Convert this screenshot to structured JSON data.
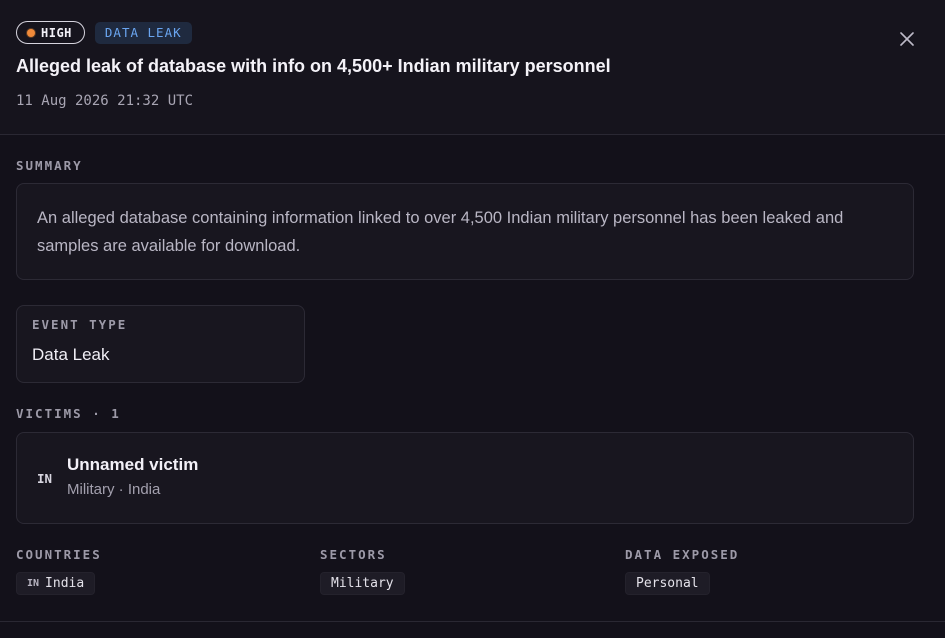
{
  "header": {
    "severity_label": "HIGH",
    "type_label": "DATA LEAK",
    "title": "Alleged leak of database with info on 4,500+ Indian military personnel",
    "timestamp": "11 Aug 2026 21:32 UTC"
  },
  "summary": {
    "label": "SUMMARY",
    "text": "An alleged database containing information linked to over 4,500 Indian military personnel has been leaked and samples are available for download."
  },
  "event_type": {
    "label": "EVENT TYPE",
    "value": "Data Leak"
  },
  "victims": {
    "label": "VICTIMS · 1",
    "items": [
      {
        "code": "IN",
        "name": "Unnamed victim",
        "meta": "Military · India"
      }
    ]
  },
  "countries": {
    "label": "COUNTRIES",
    "items": [
      {
        "code": "IN",
        "name": "India"
      }
    ]
  },
  "sectors": {
    "label": "SECTORS",
    "items": [
      "Military"
    ]
  },
  "data_exposed": {
    "label": "DATA EXPOSED",
    "items": [
      "Personal"
    ]
  },
  "icons": {
    "close": "close-icon",
    "severity": "severity-dot-icon"
  },
  "colors": {
    "severity_high": "#f08a3a",
    "type_badge_text": "#6aa5f0",
    "type_badge_bg": "#1f2a3f"
  }
}
